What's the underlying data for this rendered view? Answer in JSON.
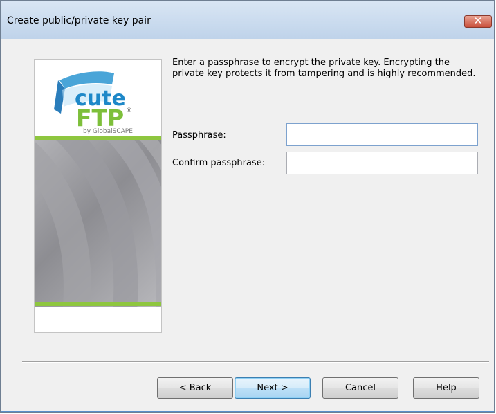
{
  "window": {
    "title": "Create public/private key pair"
  },
  "logo": {
    "text_cute": "cute",
    "text_ftp": "FTP",
    "trademark": "®",
    "byline": "by GlobalSCAPE"
  },
  "content": {
    "description": "Enter a passphrase to encrypt the private key. Encrypting the private key protects it from tampering and is highly recommended.",
    "passphrase_label": "Passphrase:",
    "passphrase_value": "",
    "confirm_label": "Confirm passphrase:",
    "confirm_value": ""
  },
  "buttons": {
    "back": "< Back",
    "next": "Next >",
    "cancel": "Cancel",
    "help": "Help"
  },
  "colors": {
    "accent_green": "#8ec63f",
    "logo_blue": "#1e88c8",
    "close_red": "#c9503c"
  }
}
